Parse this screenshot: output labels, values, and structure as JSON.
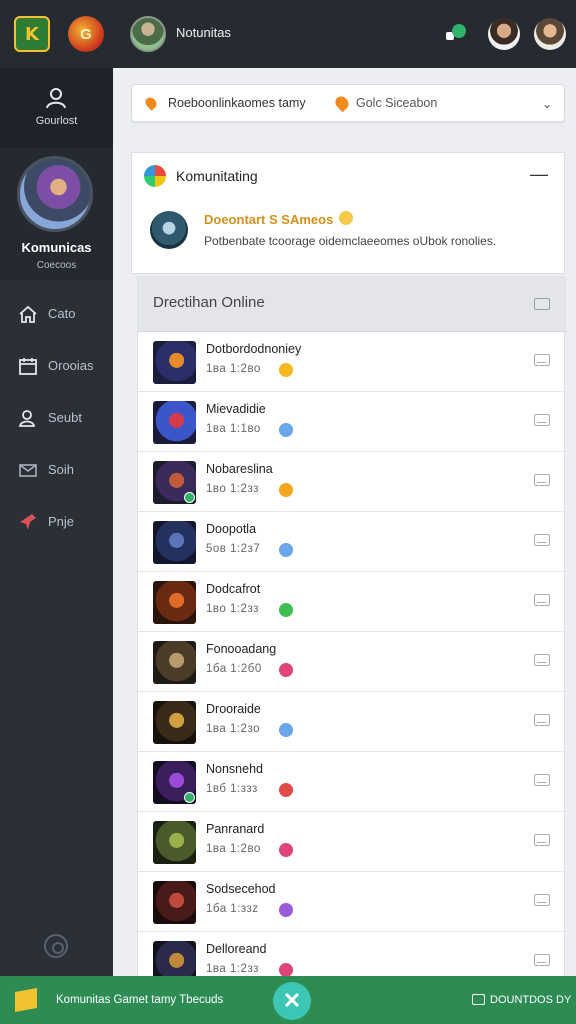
{
  "topbar": {
    "logo_left_text": "K",
    "logo_second_text": "G",
    "title": "Notunitas"
  },
  "sidebar": {
    "top_label": "Gourlost",
    "profile": {
      "name": "Komunicas",
      "sub": "Coecoos"
    },
    "nav": [
      {
        "label": "Cato",
        "icon": "home-icon"
      },
      {
        "label": "Orooias",
        "icon": "calendar-icon"
      },
      {
        "label": "Seubt",
        "icon": "user-search-icon"
      },
      {
        "label": "Soih",
        "icon": "mail-icon"
      },
      {
        "label": "Pnje",
        "icon": "pin-icon"
      }
    ]
  },
  "dropdown": {
    "left_text": "Roeboonlinkaomes tamy",
    "right_text": "Golc Siceabon",
    "chevron": "⌄"
  },
  "card": {
    "title": "Komunitating",
    "collapse": "—",
    "headline": "Doeontart S SAmeos",
    "text": "Potbenbate tcoorage oidemclaeeomes oUbok ronolies."
  },
  "list": {
    "header": "Drectihan Online",
    "rows": [
      {
        "name": "Dotbordodnoniey",
        "time": "1ва 1:2во",
        "dot_color": "#f5b820",
        "badge": false,
        "palette": [
          "#2a2f6a",
          "#e58a2a",
          "#1b1d3c"
        ]
      },
      {
        "name": "Mievadidie",
        "time": "1ва 1:1во",
        "dot_color": "#6aa6e8",
        "badge": false,
        "palette": [
          "#3a56c9",
          "#d43a4a",
          "#1a1a3a"
        ]
      },
      {
        "name": "Nobareslina",
        "time": "1во 1:2зз",
        "dot_color": "#f5a623",
        "badge": true,
        "palette": [
          "#3b2a5c",
          "#c15a3a",
          "#1c1c2c"
        ]
      },
      {
        "name": "Doopotla",
        "time": "5ов 1:2з7",
        "dot_color": "#6aa6e8",
        "badge": false,
        "palette": [
          "#24305e",
          "#5b74b8",
          "#12162e"
        ]
      },
      {
        "name": "Dodcafrot",
        "time": "1во 1:2зз",
        "dot_color": "#3dbf52",
        "badge": false,
        "palette": [
          "#6a2a12",
          "#e06a2a",
          "#2a140c"
        ]
      },
      {
        "name": "Fonooadang",
        "time": "1ба 1:2б0",
        "dot_color": "#e0457a",
        "badge": false,
        "palette": [
          "#4b3c2a",
          "#b89a6a",
          "#1e1a14"
        ]
      },
      {
        "name": "Drooraide",
        "time": "1ва 1:2зо",
        "dot_color": "#6aa6e8",
        "badge": false,
        "palette": [
          "#3a2a1a",
          "#d0a040",
          "#17130c"
        ]
      },
      {
        "name": "Nonsnehd",
        "time": "1вб 1:ззз",
        "dot_color": "#e24a4a",
        "badge": true,
        "palette": [
          "#3a1f5c",
          "#9a4ad8",
          "#140c22"
        ]
      },
      {
        "name": "Panranard",
        "time": "1ва 1:2во",
        "dot_color": "#e0457a",
        "badge": false,
        "palette": [
          "#4a5a2a",
          "#9ab04a",
          "#1a2010"
        ]
      },
      {
        "name": "Sodsecehod",
        "time": "1ба 1:ззz",
        "dot_color": "#9a5ad8",
        "badge": false,
        "palette": [
          "#4a1a1a",
          "#c04a3a",
          "#1a0c0c"
        ]
      },
      {
        "name": "Delloreand",
        "time": "1ва 1:2зз",
        "dot_color": "#e0457a",
        "badge": false,
        "palette": [
          "#2a2a4a",
          "#c08a3a",
          "#12121e"
        ]
      }
    ]
  },
  "bottombar": {
    "text": "Komunitas Gamet tamy Tbecuds",
    "close": "✕",
    "right_text": "DOUNTDOS DY"
  }
}
